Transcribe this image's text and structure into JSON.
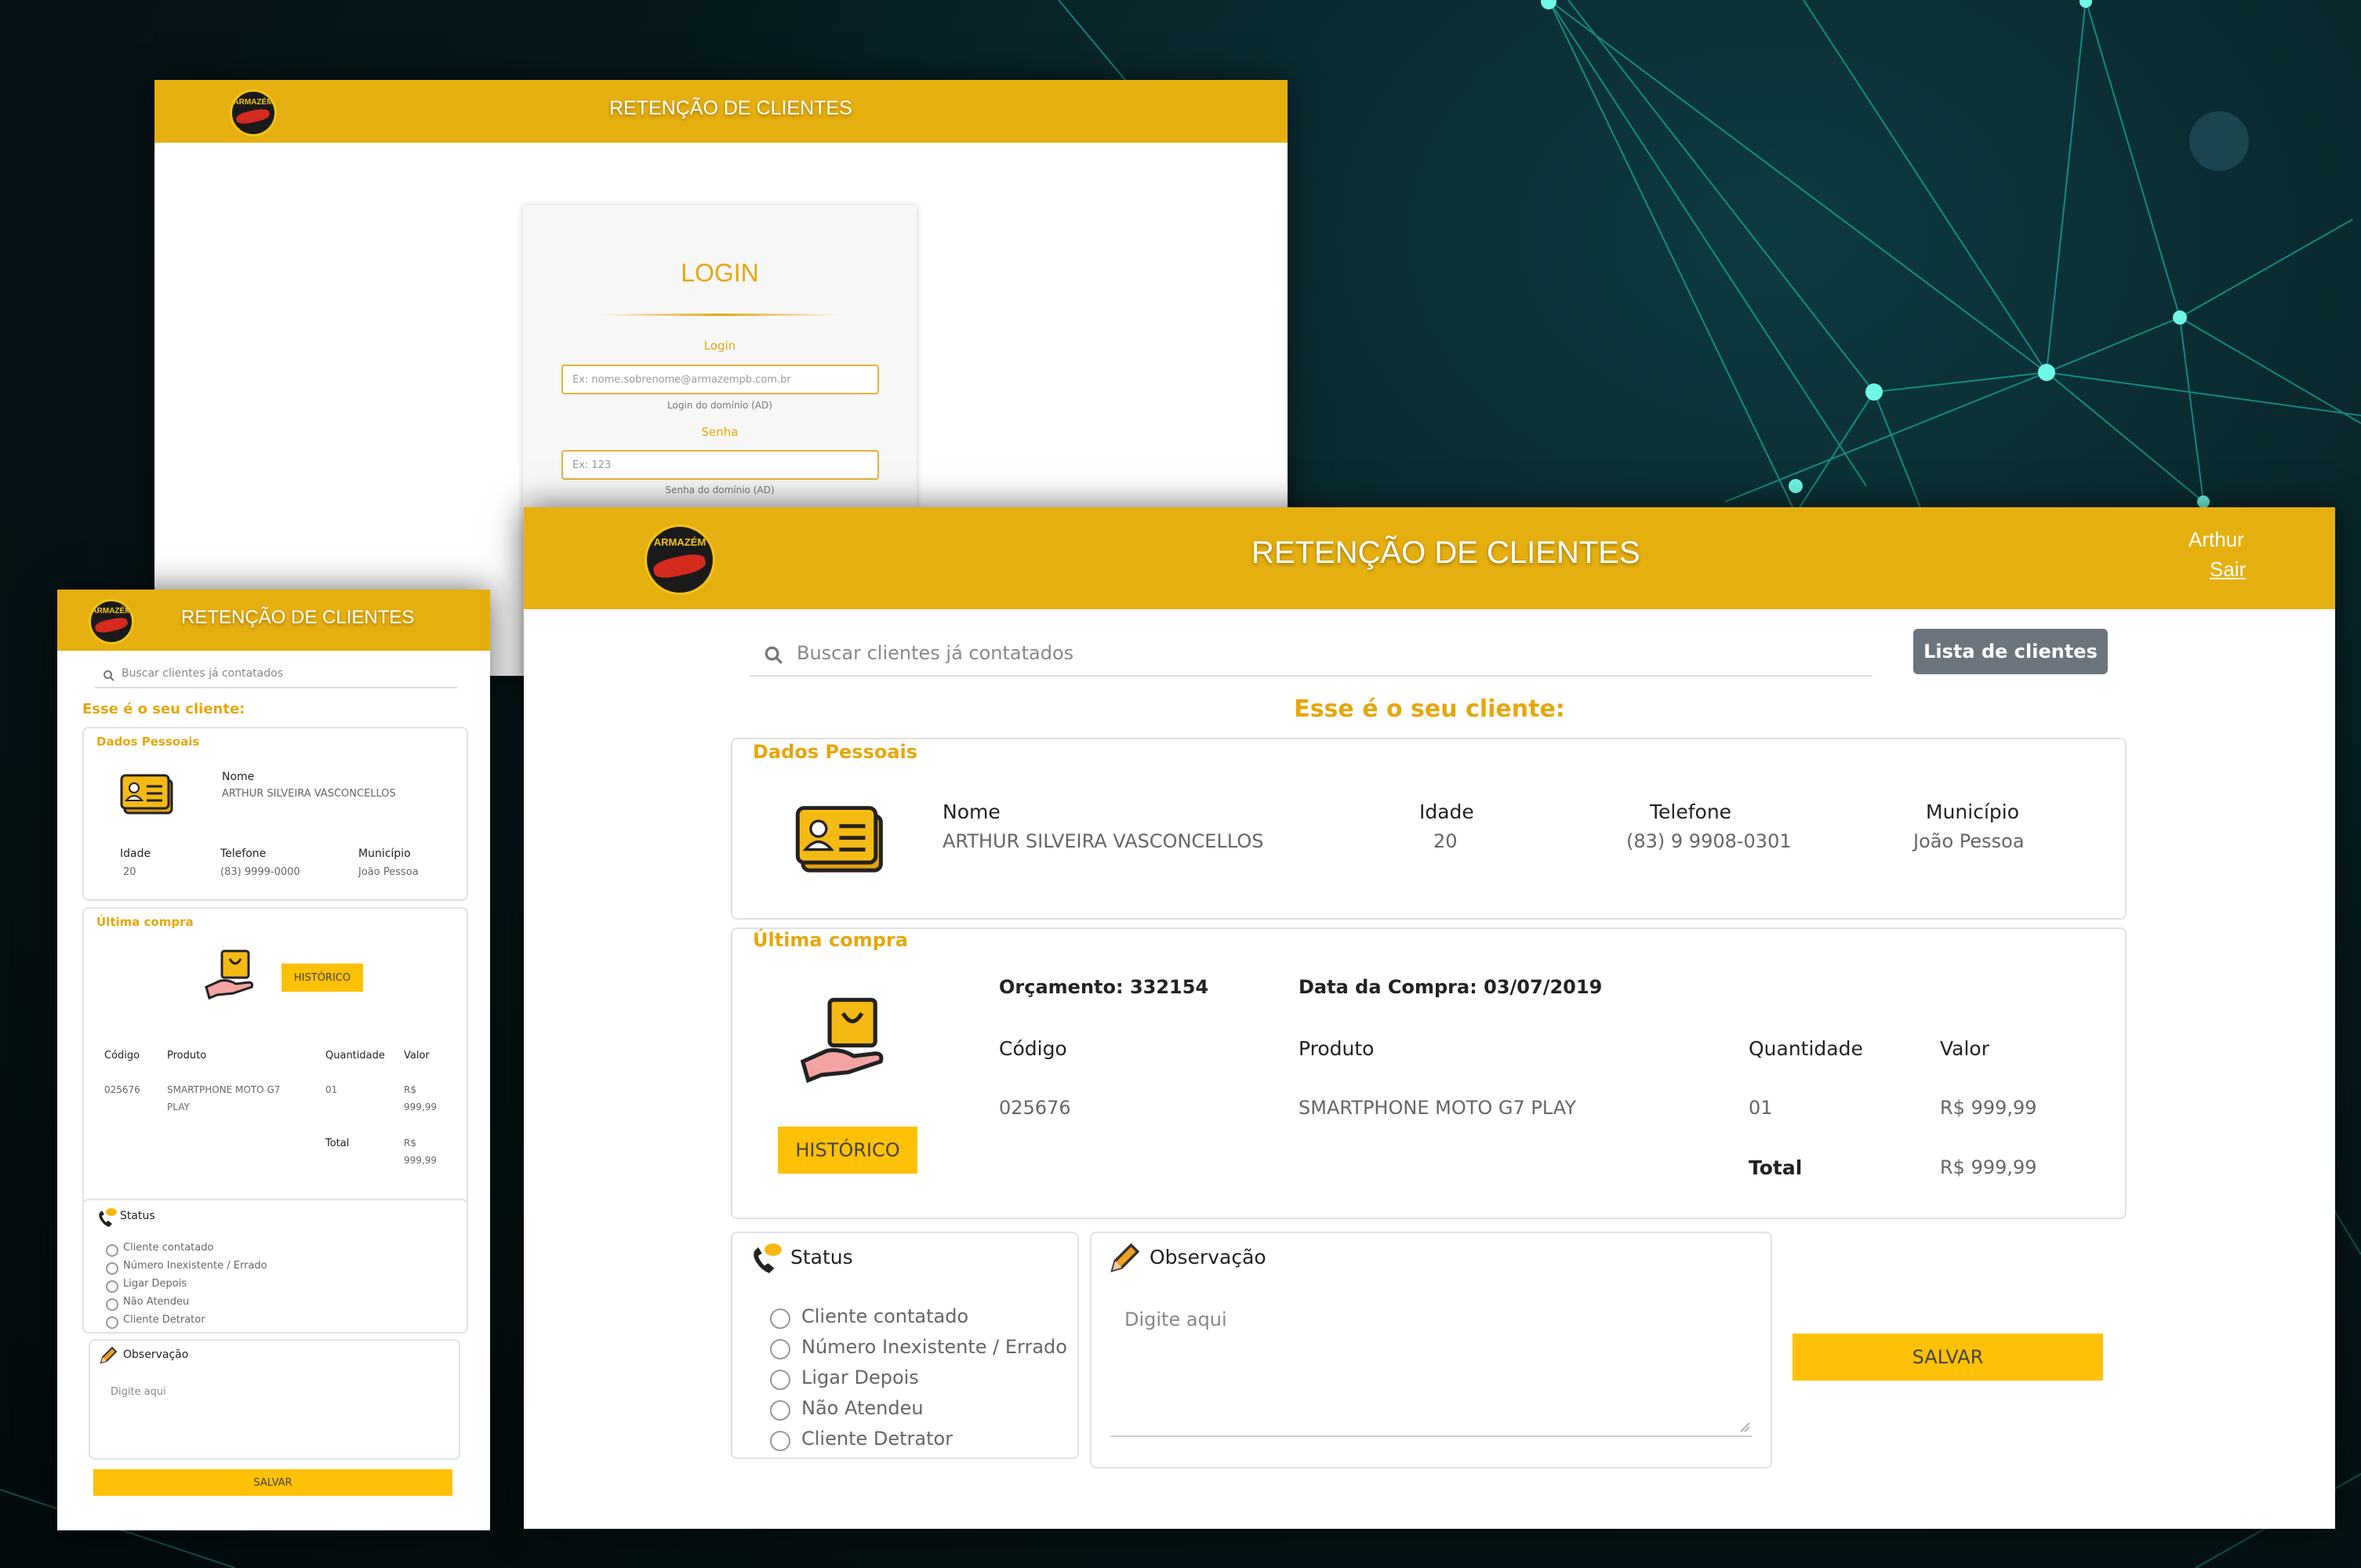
{
  "app_title": "RETENÇÃO DE CLIENTES",
  "logo": {
    "brand_top": "ARMAZÉM",
    "brand_script": "Paraíba"
  },
  "colors": {
    "accent": "#e6af10",
    "button": "#ffc107",
    "secondary_button": "#6c757d"
  },
  "login": {
    "heading": "LOGIN",
    "login_label": "Login",
    "login_placeholder": "Ex: nome.sobrenome@armazempb.com.br",
    "login_help": "Login do domínio (AD)",
    "password_label": "Senha",
    "password_placeholder": "Ex: 123",
    "password_help": "Senha do domínio (AD)"
  },
  "user": {
    "name": "Arthur",
    "logout": "Sair"
  },
  "search": {
    "placeholder": "Buscar clientes já contatados",
    "icon": "search-icon"
  },
  "list_button": "Lista de clientes",
  "client_heading": "Esse é o seu cliente:",
  "personal": {
    "title": "Dados Pessoais",
    "icon": "id-card-icon",
    "name_label": "Nome",
    "name": "ARTHUR SILVEIRA VASCONCELLOS",
    "age_label": "Idade",
    "age": "20",
    "phone_label": "Telefone",
    "phone": "(83) 9 9908-0301",
    "phone_mobile": "(83) 9999-0000",
    "city_label": "Município",
    "city": "João Pessoa"
  },
  "purchase": {
    "title": "Última compra",
    "icon": "shopping-bag-hand-icon",
    "budget_label": "Orçamento: 332154",
    "date_label": "Data da Compra: 03/07/2019",
    "history_button": "HISTÓRICO",
    "columns": [
      "Código",
      "Produto",
      "Quantidade",
      "Valor"
    ],
    "row": {
      "code": "025676",
      "product": "SMARTPHONE MOTO G7 PLAY",
      "qty": "01",
      "value": "R$ 999,99"
    },
    "mobile_product_lines": [
      "SMARTPHONE MOTO G7",
      "PLAY"
    ],
    "mobile_value_lines": [
      "R$",
      "999,99"
    ],
    "total_label": "Total",
    "total_value": "R$ 999,99"
  },
  "status": {
    "title": "Status",
    "icon": "phone-chat-icon",
    "options": [
      "Cliente contatado",
      "Número Inexistente / Errado",
      "Ligar Depois",
      "Não Atendeu",
      "Cliente Detrator"
    ]
  },
  "observation": {
    "title": "Observação",
    "icon": "pencil-icon",
    "placeholder": "Digite aqui"
  },
  "save_button": "SALVAR"
}
